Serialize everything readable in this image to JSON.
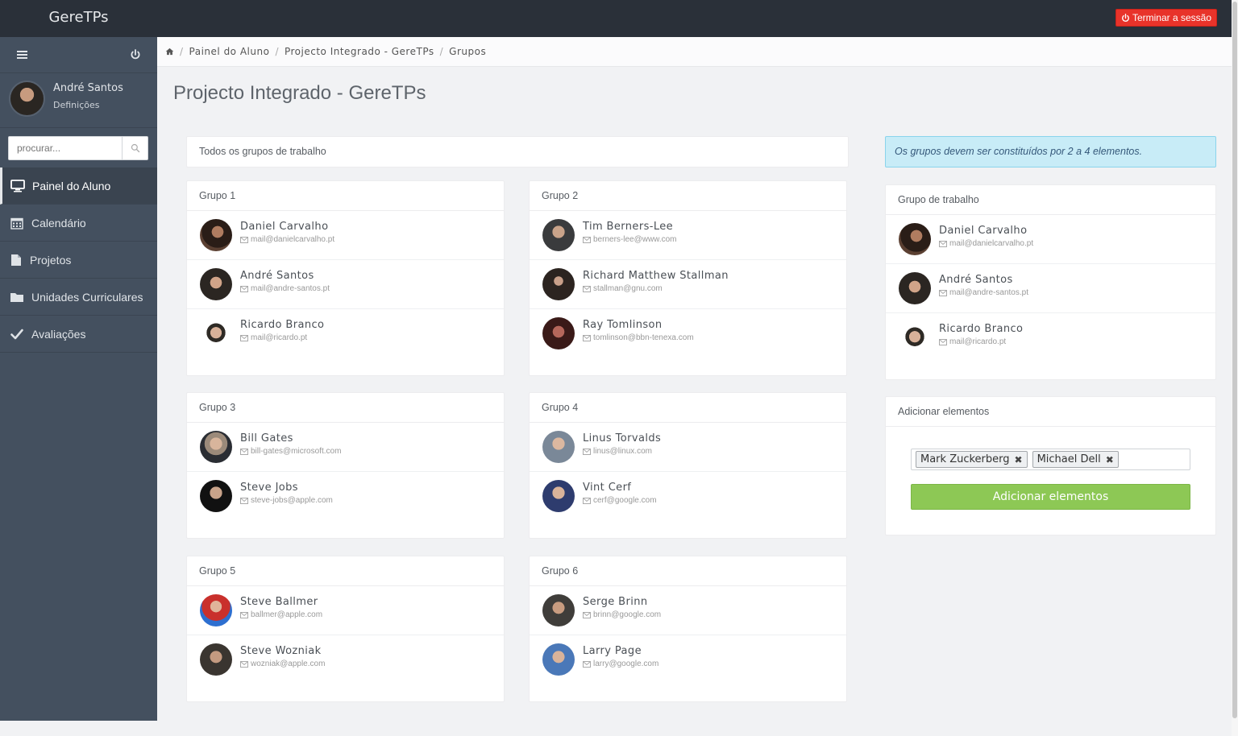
{
  "app": {
    "brand": "GereTPs",
    "logout_label": "Terminar a sessão"
  },
  "sidebar": {
    "user_name": "André Santos",
    "user_settings": "Definições",
    "search_placeholder": "procurar...",
    "items": [
      {
        "label": "Painel do Aluno",
        "icon": "monitor-icon",
        "active": true
      },
      {
        "label": "Calendário",
        "icon": "calendar-icon"
      },
      {
        "label": "Projetos",
        "icon": "file-icon"
      },
      {
        "label": "Unidades Curriculares",
        "icon": "folder-icon"
      },
      {
        "label": "Avaliações",
        "icon": "check-icon"
      }
    ]
  },
  "breadcrumb": [
    "Painel do Aluno",
    "Projecto Integrado - GereTPs",
    "Grupos"
  ],
  "page_title": "Projecto Integrado - GereTPs",
  "all_groups_title": "Todos os grupos de trabalho",
  "groups": [
    {
      "name": "Grupo 1",
      "members": [
        {
          "name": "Daniel Carvalho",
          "email": "mail@danielcarvalho.pt"
        },
        {
          "name": "André Santos",
          "email": "mail@andre-santos.pt"
        },
        {
          "name": "Ricardo Branco",
          "email": "mail@ricardo.pt"
        }
      ]
    },
    {
      "name": "Grupo 2",
      "members": [
        {
          "name": "Tim Berners-Lee",
          "email": "berners-lee@www.com"
        },
        {
          "name": "Richard Matthew Stallman",
          "email": "stallman@gnu.com"
        },
        {
          "name": "Ray Tomlinson",
          "email": "tomlinson@bbn-tenexa.com"
        }
      ]
    },
    {
      "name": "Grupo 3",
      "members": [
        {
          "name": "Bill Gates",
          "email": "bill-gates@microsoft.com"
        },
        {
          "name": "Steve Jobs",
          "email": "steve-jobs@apple.com"
        }
      ]
    },
    {
      "name": "Grupo 4",
      "members": [
        {
          "name": "Linus Torvalds",
          "email": "linus@linux.com"
        },
        {
          "name": "Vint Cerf",
          "email": "cerf@google.com"
        }
      ]
    },
    {
      "name": "Grupo 5",
      "members": [
        {
          "name": "Steve Ballmer",
          "email": "ballmer@apple.com"
        },
        {
          "name": "Steve Wozniak",
          "email": "wozniak@apple.com"
        }
      ]
    },
    {
      "name": "Grupo 6",
      "members": [
        {
          "name": "Serge Brinn",
          "email": "brinn@google.com"
        },
        {
          "name": "Larry Page",
          "email": "larry@google.com"
        }
      ]
    }
  ],
  "alert_text": "Os grupos devem ser constituídos por 2 a 4 elementos.",
  "my_group": {
    "title": "Grupo de trabalho",
    "members": [
      {
        "name": "Daniel Carvalho",
        "email": "mail@danielcarvalho.pt"
      },
      {
        "name": "André Santos",
        "email": "mail@andre-santos.pt"
      },
      {
        "name": "Ricardo Branco",
        "email": "mail@ricardo.pt"
      }
    ]
  },
  "add_members": {
    "title": "Adicionar elementos",
    "tags": [
      "Mark Zuckerberg",
      "Michael Dell"
    ],
    "button_label": "Adicionar elementos"
  },
  "colors": {
    "accent_green": "#8dc855",
    "logout_red": "#e8332a",
    "sidebar": "#44505f",
    "topbar": "#2a3039",
    "alert_bg": "#c8ecf7"
  }
}
